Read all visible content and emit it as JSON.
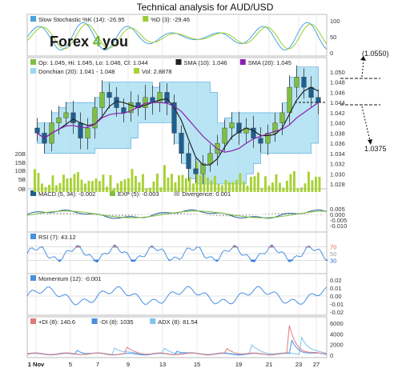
{
  "title": "Technical analysis for AUD/USD",
  "brand": {
    "text_a": "Forex",
    "text_b": "4",
    "text_c": "you",
    "color_a": "#1a1a1a",
    "color_b": "#6ab42d"
  },
  "callouts": {
    "upper": "(1.0550)",
    "lower": "1.0375"
  },
  "colors": {
    "bull": "#7fbf3f",
    "bear": "#1f5f8f",
    "band": "#9ad8f0",
    "sma10": "#222222",
    "sma20": "#8a1fb0",
    "vol": "#a7d234",
    "grid": "#dddddd",
    "plus_di": "#e27a7a",
    "minus_di": "#4a90e2",
    "adx": "#7fc3f0",
    "rsi_over": "#e06060",
    "rsi_under": "#3070d0",
    "stoch_k": "#4aa3df",
    "stoch_d": "#9acd32"
  },
  "panels": [
    {
      "id": "stochastic",
      "legend": [
        {
          "label": "Slow Stochastic %K (14): -26.95",
          "color": "#4aa3df"
        },
        {
          "label": "%D (3): -29.46",
          "color": "#9acd32"
        }
      ]
    },
    {
      "id": "price",
      "legend": [
        {
          "label": "Op: 1.045, Hi: 1.045, Lo: 1.046, Cl: 1.044",
          "color": "#7fbf3f"
        },
        {
          "label": "SMA (10): 1.046",
          "color": "#222222"
        },
        {
          "label": "SMA (20): 1.045",
          "color": "#8a1fb0"
        },
        {
          "label": "Donchian (20): 1.041 - 1.048",
          "color": "#9ad8f0"
        },
        {
          "label": "Vol: 2.8878",
          "color": "#a7d234"
        }
      ]
    },
    {
      "id": "macd",
      "legend": [
        {
          "label": "MACD (5, 34): -0.002",
          "color": "#1f5f8f"
        },
        {
          "label": "EXP (5): -0.003",
          "color": "#7fbf3f"
        },
        {
          "label": "Divergence: 0.001",
          "color": "#bbbbbb"
        }
      ]
    },
    {
      "id": "rsi",
      "legend": [
        {
          "label": "RSI (7): 43.12",
          "color": "#4a90e2"
        }
      ]
    },
    {
      "id": "momentum",
      "legend": [
        {
          "label": "Momentum (12): -0.001",
          "color": "#4a90e2"
        }
      ]
    },
    {
      "id": "dmi",
      "legend": [
        {
          "label": "+DI (8): 140.6",
          "color": "#e27a7a"
        },
        {
          "label": "-DI (8): 1035",
          "color": "#4a90e2"
        },
        {
          "label": "ADX (8): 81.54",
          "color": "#7fc3f0"
        }
      ]
    }
  ],
  "axes": {
    "stochastic": [
      "100",
      "50",
      "0"
    ],
    "price": [
      "1.050",
      "1.048",
      "1.046",
      "1.044",
      "1.042",
      "1.040",
      "1.038",
      "1.036",
      "1.034",
      "1.032",
      "1.030",
      "1.028"
    ],
    "volume": [
      "20B",
      "15B",
      "10B",
      "5B",
      "0B"
    ],
    "macd": [
      "0.005",
      "0.000",
      "-0.005",
      "-0.010"
    ],
    "rsi": [
      "70",
      "50",
      "30"
    ],
    "momentum": [
      "0.02",
      "0.01",
      "0.00",
      "-0.01",
      "-0.02"
    ],
    "dmi": [
      "6000",
      "4000",
      "2000",
      "0"
    ],
    "x": [
      "1 Nov",
      "5",
      "7",
      "9",
      "13",
      "15",
      "19",
      "21",
      "23",
      "27"
    ]
  },
  "chart_data": {
    "type": "line",
    "title": "Technical analysis for AUD/USD",
    "x_dates": [
      "1 Nov",
      "5",
      "7",
      "9",
      "13",
      "15",
      "19",
      "21",
      "23",
      "27"
    ],
    "price_range": [
      1.028,
      1.05
    ],
    "close_approx": [
      1.038,
      1.036,
      1.04,
      1.041,
      1.042,
      1.04,
      1.037,
      1.039,
      1.043,
      1.046,
      1.045,
      1.043,
      1.042,
      1.044,
      1.043,
      1.045,
      1.044,
      1.046,
      1.044,
      1.038,
      1.034,
      1.031,
      1.03,
      1.032,
      1.034,
      1.036,
      1.039,
      1.04,
      1.038,
      1.039,
      1.037,
      1.036,
      1.038,
      1.04,
      1.042,
      1.047,
      1.049,
      1.047,
      1.045,
      1.044
    ],
    "volume_range": [
      0,
      20000000000
    ],
    "stochastic_range": [
      0,
      100
    ],
    "rsi_levels": [
      30,
      50,
      70
    ],
    "dmi_range": [
      0,
      6000
    ],
    "callouts": [
      1.055,
      1.0375
    ]
  }
}
